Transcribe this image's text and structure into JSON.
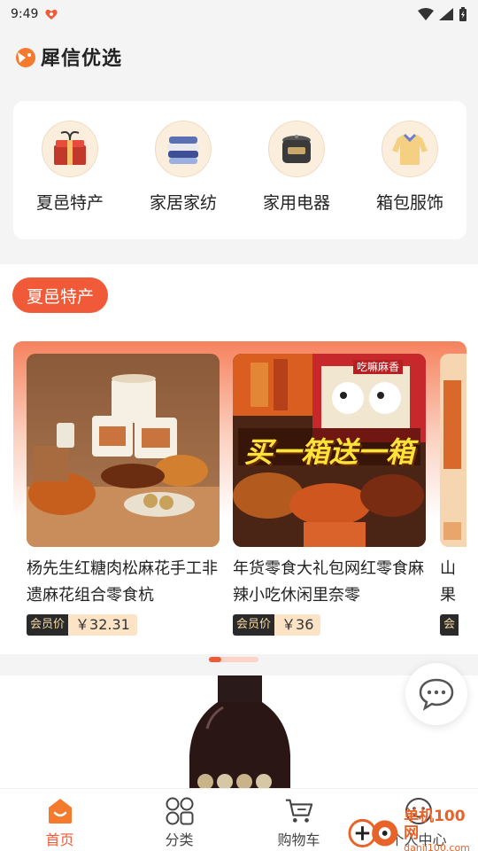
{
  "status_bar": {
    "time": "9:49"
  },
  "app": {
    "name": "犀信优选"
  },
  "categories": [
    {
      "label": "夏邑特产",
      "icon": "gift-box-icon"
    },
    {
      "label": "家居家纺",
      "icon": "folded-textiles-icon"
    },
    {
      "label": "家用电器",
      "icon": "rice-cooker-icon"
    },
    {
      "label": "箱包服饰",
      "icon": "sweater-icon"
    }
  ],
  "section": {
    "title": "夏邑特产"
  },
  "products": [
    {
      "title": "杨先生红糖肉松麻花手工非遗麻花组合零食杭",
      "member_label": "会员价",
      "price": "￥32.31"
    },
    {
      "title": "年货零食大礼包网红零食麻辣小吃休闲里奈零",
      "member_label": "会员价",
      "price": "￥36",
      "banner_text": "买一箱送一箱",
      "sign_text": "吃嘛麻香"
    },
    {
      "title": "山果",
      "member_label": "会"
    }
  ],
  "tabbar": [
    {
      "label": "首页",
      "icon": "home-icon",
      "active": true
    },
    {
      "label": "分类",
      "icon": "category-grid-icon",
      "active": false
    },
    {
      "label": "购物车",
      "icon": "cart-icon",
      "active": false
    },
    {
      "label": "个人中心",
      "icon": "profile-icon",
      "active": false
    }
  ],
  "watermark": {
    "main": "单机100网",
    "sub": "danji100.com"
  },
  "colors": {
    "accent": "#f15a38",
    "member_tag_bg": "#2a2a2a",
    "price_bg": "#fde3c6"
  }
}
